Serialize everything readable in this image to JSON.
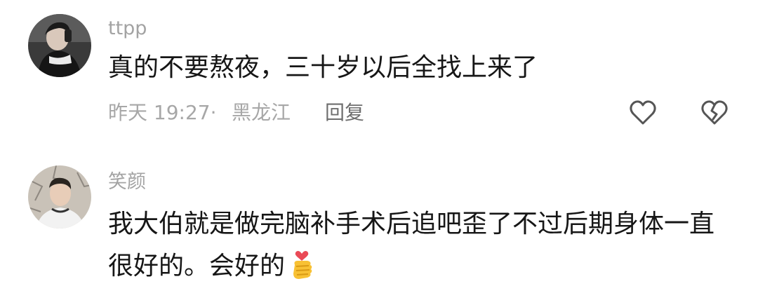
{
  "comments": [
    {
      "username": "ttpp",
      "text": "真的不要熬夜，三十岁以后全找上来了",
      "time": "昨天 19:27·",
      "location": "黑龙江",
      "reply_label": "回复"
    },
    {
      "username": "笑颜",
      "text_line1": "我大伯就是做完脑补手术后追吧歪了不过后期身体一直",
      "text_line2": "很好的。会好的",
      "emoji": "finger-heart-emoji"
    }
  ],
  "icons": {
    "like": "heart-outline-icon",
    "dislike": "broken-heart-icon"
  },
  "colors": {
    "username": "#a3a3a3",
    "text": "#161616",
    "meta": "#a7a7a7",
    "reply": "#6e6e6e",
    "icon": "#555555"
  }
}
